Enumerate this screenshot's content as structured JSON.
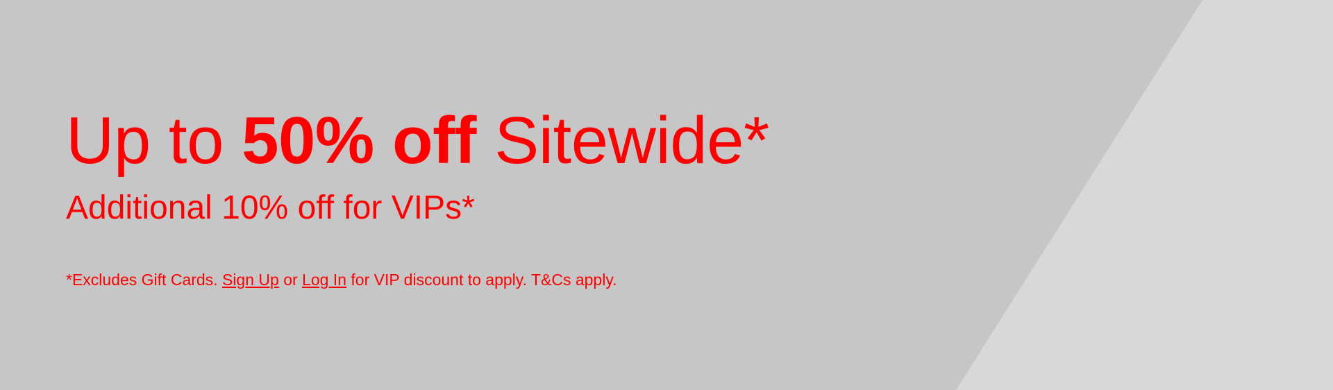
{
  "banner": {
    "headline": {
      "prefix": "Up to",
      "emphasis": "50% off",
      "suffix": "Sitewide*"
    },
    "subheadline": "Additional 10% off for VIPs*",
    "disclaimer": {
      "lead": "*Excludes Gift Cards.",
      "sign_up_link": "Sign Up",
      "connector": "or",
      "log_in_link": "Log In",
      "tail": "for VIP discount to apply. T&Cs apply."
    },
    "colors": {
      "background": "#c6c6c6",
      "panel": "#d8d8d8",
      "text": "#ff0000"
    }
  }
}
